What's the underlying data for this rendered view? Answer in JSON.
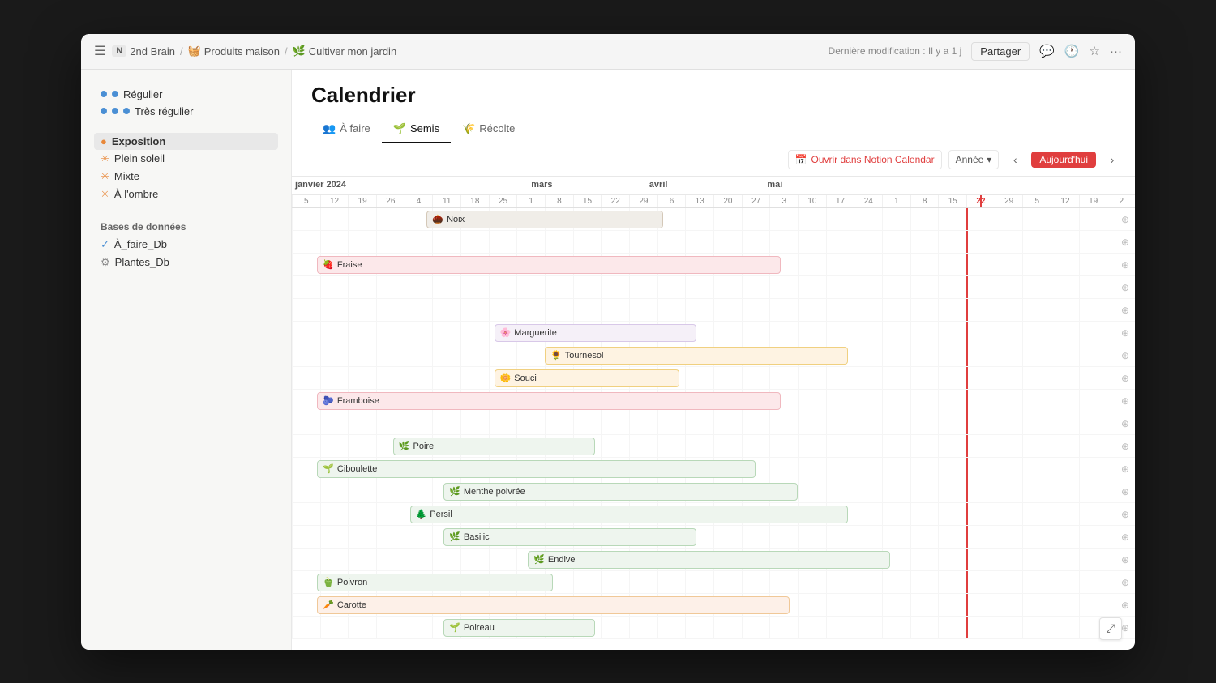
{
  "titlebar": {
    "menu_icon": "☰",
    "breadcrumb": [
      {
        "label": "2nd Brain",
        "icon": "N",
        "icon_bg": "#e8e8e8"
      },
      {
        "label": "Produits maison",
        "icon": "🧺"
      },
      {
        "label": "Cultiver mon jardin",
        "icon": "🌿"
      }
    ],
    "last_modified": "Dernière modification : Il y a 1 j",
    "share_label": "Partager"
  },
  "sidebar": {
    "watering_section": {
      "items": [
        {
          "label": "Régulier",
          "dots": 2,
          "dot_color": "blue"
        },
        {
          "label": "Très régulier",
          "dots": 3,
          "dot_color": "blue"
        }
      ]
    },
    "exposure_section": {
      "title": "Exposition",
      "items": [
        {
          "label": "Plein soleil",
          "icon": "✳️"
        },
        {
          "label": "Mixte",
          "icon": "✳️"
        },
        {
          "label": "À l'ombre",
          "icon": "✳️"
        }
      ]
    },
    "databases_section": {
      "title": "Bases de données",
      "items": [
        {
          "label": "À_faire_Db",
          "icon": "✓"
        },
        {
          "label": "Plantes_Db",
          "icon": "⚙"
        }
      ]
    }
  },
  "page": {
    "title": "Calendrier",
    "tabs": [
      {
        "label": "À faire",
        "icon": "👥",
        "active": false
      },
      {
        "label": "Semis",
        "icon": "🌱",
        "active": true
      },
      {
        "label": "Récolte",
        "icon": "🌾",
        "active": false
      }
    ]
  },
  "calendar": {
    "open_notion_label": "Ouvrir dans Notion Calendar",
    "view_label": "Année",
    "today_label": "Aujourd'hui",
    "months": [
      {
        "label": "janvier 2024",
        "width_pct": 14
      },
      {
        "label": "mars",
        "width_pct": 14
      },
      {
        "label": "avril",
        "width_pct": 12
      },
      {
        "label": "mai",
        "width_pct": 12
      },
      {
        "label": "",
        "width_pct": 48
      }
    ],
    "week_labels": [
      "5",
      "12",
      "19",
      "26",
      "4",
      "11",
      "18",
      "25",
      "1",
      "8",
      "15",
      "22",
      "29",
      "6",
      "13",
      "20",
      "27",
      "3",
      "10",
      "17",
      "24",
      "1",
      "8",
      "15",
      "22",
      "29",
      "5",
      "12",
      "19",
      "2"
    ],
    "today_week_index": 24,
    "plants": [
      {
        "name": "Noix",
        "icon": "🌰",
        "start_pct": 16,
        "width_pct": 28
      },
      {
        "name": "Fraise",
        "icon": "🍓",
        "start_pct": 3,
        "width_pct": 55
      },
      {
        "name": "Marguerite",
        "icon": "🌸",
        "start_pct": 24,
        "width_pct": 24
      },
      {
        "name": "Tournesol",
        "icon": "🌻",
        "start_pct": 30,
        "width_pct": 36
      },
      {
        "name": "Souci",
        "icon": "🌼",
        "start_pct": 24,
        "width_pct": 22
      },
      {
        "name": "Framboise",
        "icon": "🫐",
        "start_pct": 3,
        "width_pct": 55
      },
      {
        "name": "Poire",
        "icon": "🌿",
        "start_pct": 12,
        "width_pct": 24
      },
      {
        "name": "Ciboulette",
        "icon": "🌱",
        "start_pct": 3,
        "width_pct": 52
      },
      {
        "name": "Menthe poivrée",
        "icon": "🌿",
        "start_pct": 18,
        "width_pct": 42
      },
      {
        "name": "Persil",
        "icon": "🌲",
        "start_pct": 14,
        "width_pct": 52
      },
      {
        "name": "Basilic",
        "icon": "🌿",
        "start_pct": 18,
        "width_pct": 30
      },
      {
        "name": "Endive",
        "icon": "🌿",
        "start_pct": 28,
        "width_pct": 43
      },
      {
        "name": "Poivron",
        "icon": "🫑",
        "start_pct": 3,
        "width_pct": 28
      },
      {
        "name": "Carotte",
        "icon": "🥕",
        "start_pct": 3,
        "width_pct": 56
      },
      {
        "name": "Poireau",
        "icon": "🌱",
        "start_pct": 18,
        "width_pct": 18
      }
    ]
  }
}
